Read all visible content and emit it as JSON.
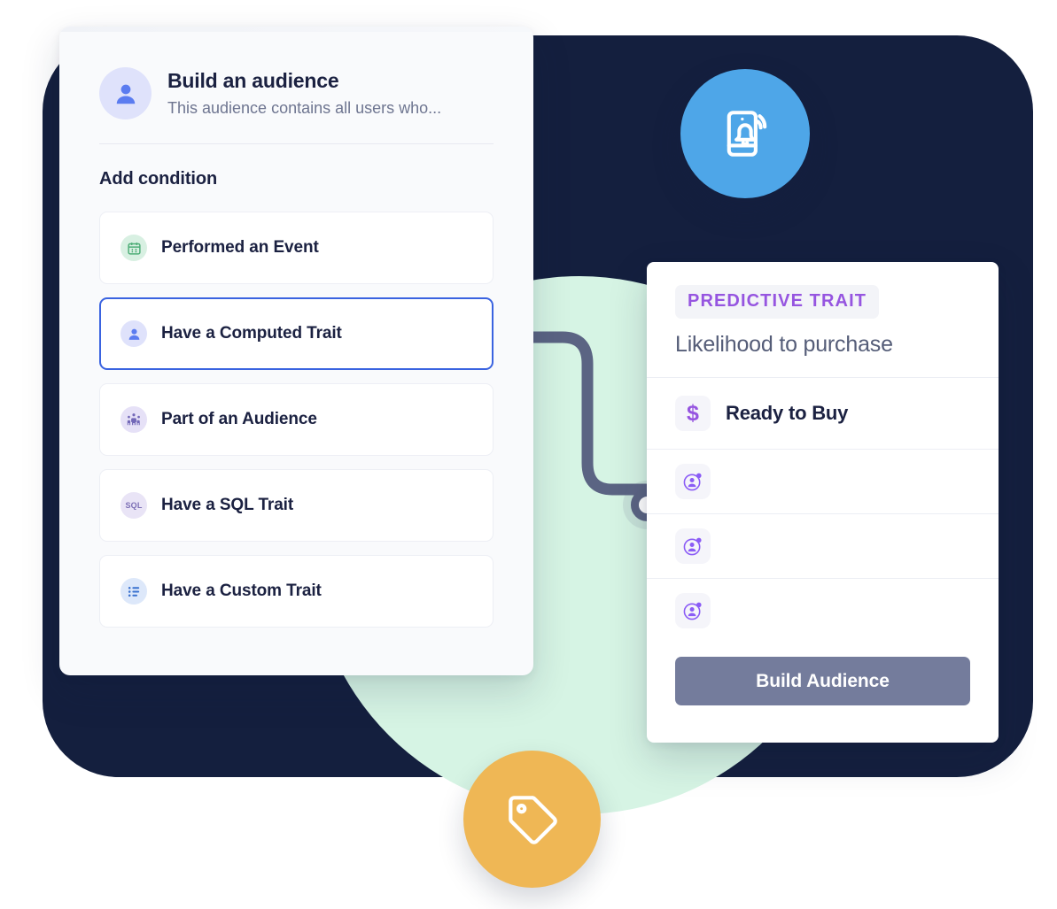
{
  "colors": {
    "background_card_navy": "#141f3e",
    "background_circle_mint": "#d6f4e4",
    "accent_selected_border": "#3a63e0",
    "accent_predictive_purple": "#9655e0",
    "badge_blue": "#4ea6e8",
    "badge_orange": "#efb755",
    "button_build_audience": "#747c9c",
    "connector_line": "#5b6483"
  },
  "audience_panel": {
    "avatar_icon": "user-avatar-icon",
    "title": "Build an audience",
    "subtitle": "This audience contains all users who...",
    "section_title": "Add condition",
    "conditions": [
      {
        "label": "Performed an Event",
        "icon": "calendar-icon",
        "icon_style": "green",
        "selected": false
      },
      {
        "label": "Have a Computed Trait",
        "icon": "user-avatar-icon",
        "icon_style": "indigo",
        "selected": true
      },
      {
        "label": "Part of an Audience",
        "icon": "people-group-icon",
        "icon_style": "violet",
        "selected": false
      },
      {
        "label": "Have a SQL Trait",
        "icon": "sql-icon",
        "icon_style": "lilac",
        "selected": false,
        "icon_text": "SQL"
      },
      {
        "label": "Have a Custom Trait",
        "icon": "list-icon",
        "icon_style": "blue",
        "selected": false
      }
    ]
  },
  "predictive_panel": {
    "badge_label": "PREDICTIVE TRAIT",
    "trait_name": "Likelihood to purchase",
    "segment": {
      "icon": "dollar-sign-icon",
      "icon_glyph": "$",
      "label": "Ready to Buy"
    },
    "user_rows": [
      {
        "icon": "user-profile-icon"
      },
      {
        "icon": "user-profile-icon"
      },
      {
        "icon": "user-profile-icon"
      }
    ],
    "build_button_label": "Build Audience"
  },
  "floating_badges": [
    {
      "name": "mobile-push-notification-icon",
      "color": "#4ea6e8"
    },
    {
      "name": "price-tag-icon",
      "color": "#efb755"
    }
  ],
  "connector": {
    "name": "flow-connector",
    "node": "connector-node"
  }
}
